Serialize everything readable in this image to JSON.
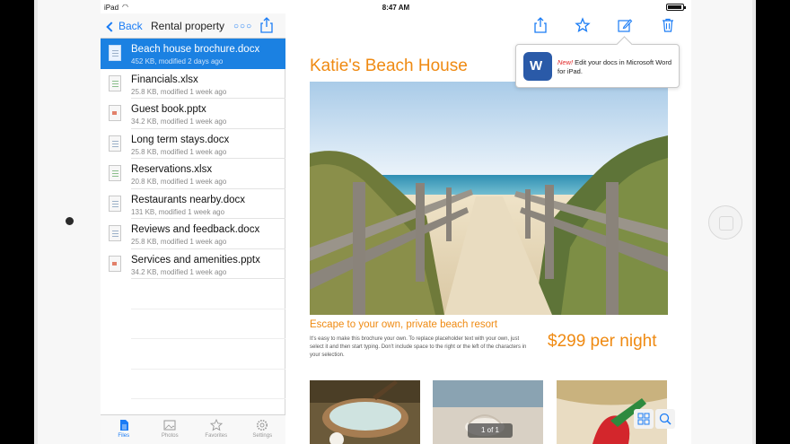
{
  "statusbar": {
    "device": "iPad",
    "time": "8:47 AM"
  },
  "sidebar": {
    "back_label": "Back",
    "title": "Rental property",
    "files": [
      {
        "name": "Beach house brochure.docx",
        "meta": "452 KB, modified 2 days ago",
        "type": "docx",
        "selected": true
      },
      {
        "name": "Financials.xlsx",
        "meta": "25.8 KB, modified 1 week ago",
        "type": "xlsx"
      },
      {
        "name": "Guest book.pptx",
        "meta": "34.2 KB, modified 1 week ago",
        "type": "pptx"
      },
      {
        "name": "Long term stays.docx",
        "meta": "25.8 KB, modified 1 week ago",
        "type": "docx"
      },
      {
        "name": "Reservations.xlsx",
        "meta": "20.8 KB, modified 1 week ago",
        "type": "xlsx"
      },
      {
        "name": "Restaurants nearby.docx",
        "meta": "131 KB, modified 1 week ago",
        "type": "docx"
      },
      {
        "name": "Reviews and feedback.docx",
        "meta": "25.8 KB, modified 1 week ago",
        "type": "docx"
      },
      {
        "name": "Services and amenities.pptx",
        "meta": "34.2 KB, modified 1 week ago",
        "type": "pptx"
      }
    ],
    "tabs": [
      {
        "label": "Files",
        "icon": "document-icon",
        "active": true
      },
      {
        "label": "Photos",
        "icon": "photo-icon"
      },
      {
        "label": "Favorites",
        "icon": "star-icon"
      },
      {
        "label": "Settings",
        "icon": "gear-icon"
      }
    ]
  },
  "document": {
    "title": "Katie's Beach House",
    "tagline": "Escape to your own, private beach resort",
    "body": "It's easy to make this brochure your own. To replace placeholder text with your own, just select it and then start typing. Don't include space to the right or the left of the characters in your selection.",
    "price": "$299 per night",
    "page_indicator": "1 of 1"
  },
  "popover": {
    "badge": "New!",
    "text": " Edit your docs in Microsoft Word for iPad."
  },
  "colors": {
    "accent": "#1a7cf5",
    "selected_row": "#1b81e2",
    "doc_orange": "#ef8a12"
  }
}
